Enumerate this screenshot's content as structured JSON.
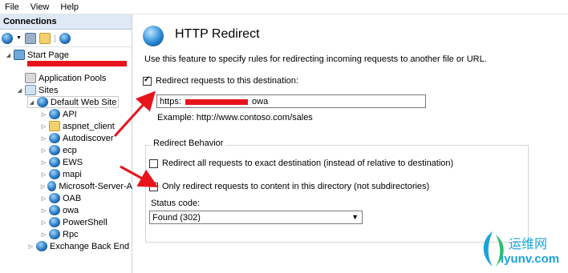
{
  "menu": [
    "File",
    "View",
    "Help"
  ],
  "connections": {
    "header": "Connections",
    "tree": {
      "start_page": "Start Page",
      "app_pools": "Application Pools",
      "sites": "Sites",
      "default_site": "Default Web Site",
      "children": [
        "API",
        "aspnet_client",
        "Autodiscover",
        "ecp",
        "EWS",
        "mapi",
        "Microsoft-Server-A",
        "OAB",
        "owa",
        "PowerShell",
        "Rpc"
      ],
      "exchange_back_end": "Exchange Back End"
    }
  },
  "feature": {
    "title": "HTTP Redirect",
    "description": "Use this feature to specify rules for redirecting incoming requests to another file or URL.",
    "redirect_checkbox_label": "Redirect requests to this destination:",
    "redirect_checked": true,
    "destination_prefix": "https:",
    "destination_suffix": "owa",
    "example": "Example: http://www.contoso.com/sales",
    "behavior": {
      "title": "Redirect Behavior",
      "exact_label": "Redirect all requests to exact destination (instead of relative to destination)",
      "exact_checked": false,
      "only_dir_label": "Only redirect requests to content in this directory (not subdirectories)",
      "only_dir_checked": true,
      "status_code_label": "Status code:",
      "status_code_value": "Found (302)"
    }
  },
  "watermark": {
    "text_cn": "运维网",
    "text_url": "iyunv.com",
    "color": "#1aa3d9"
  },
  "annotation_color": "#e8141c"
}
